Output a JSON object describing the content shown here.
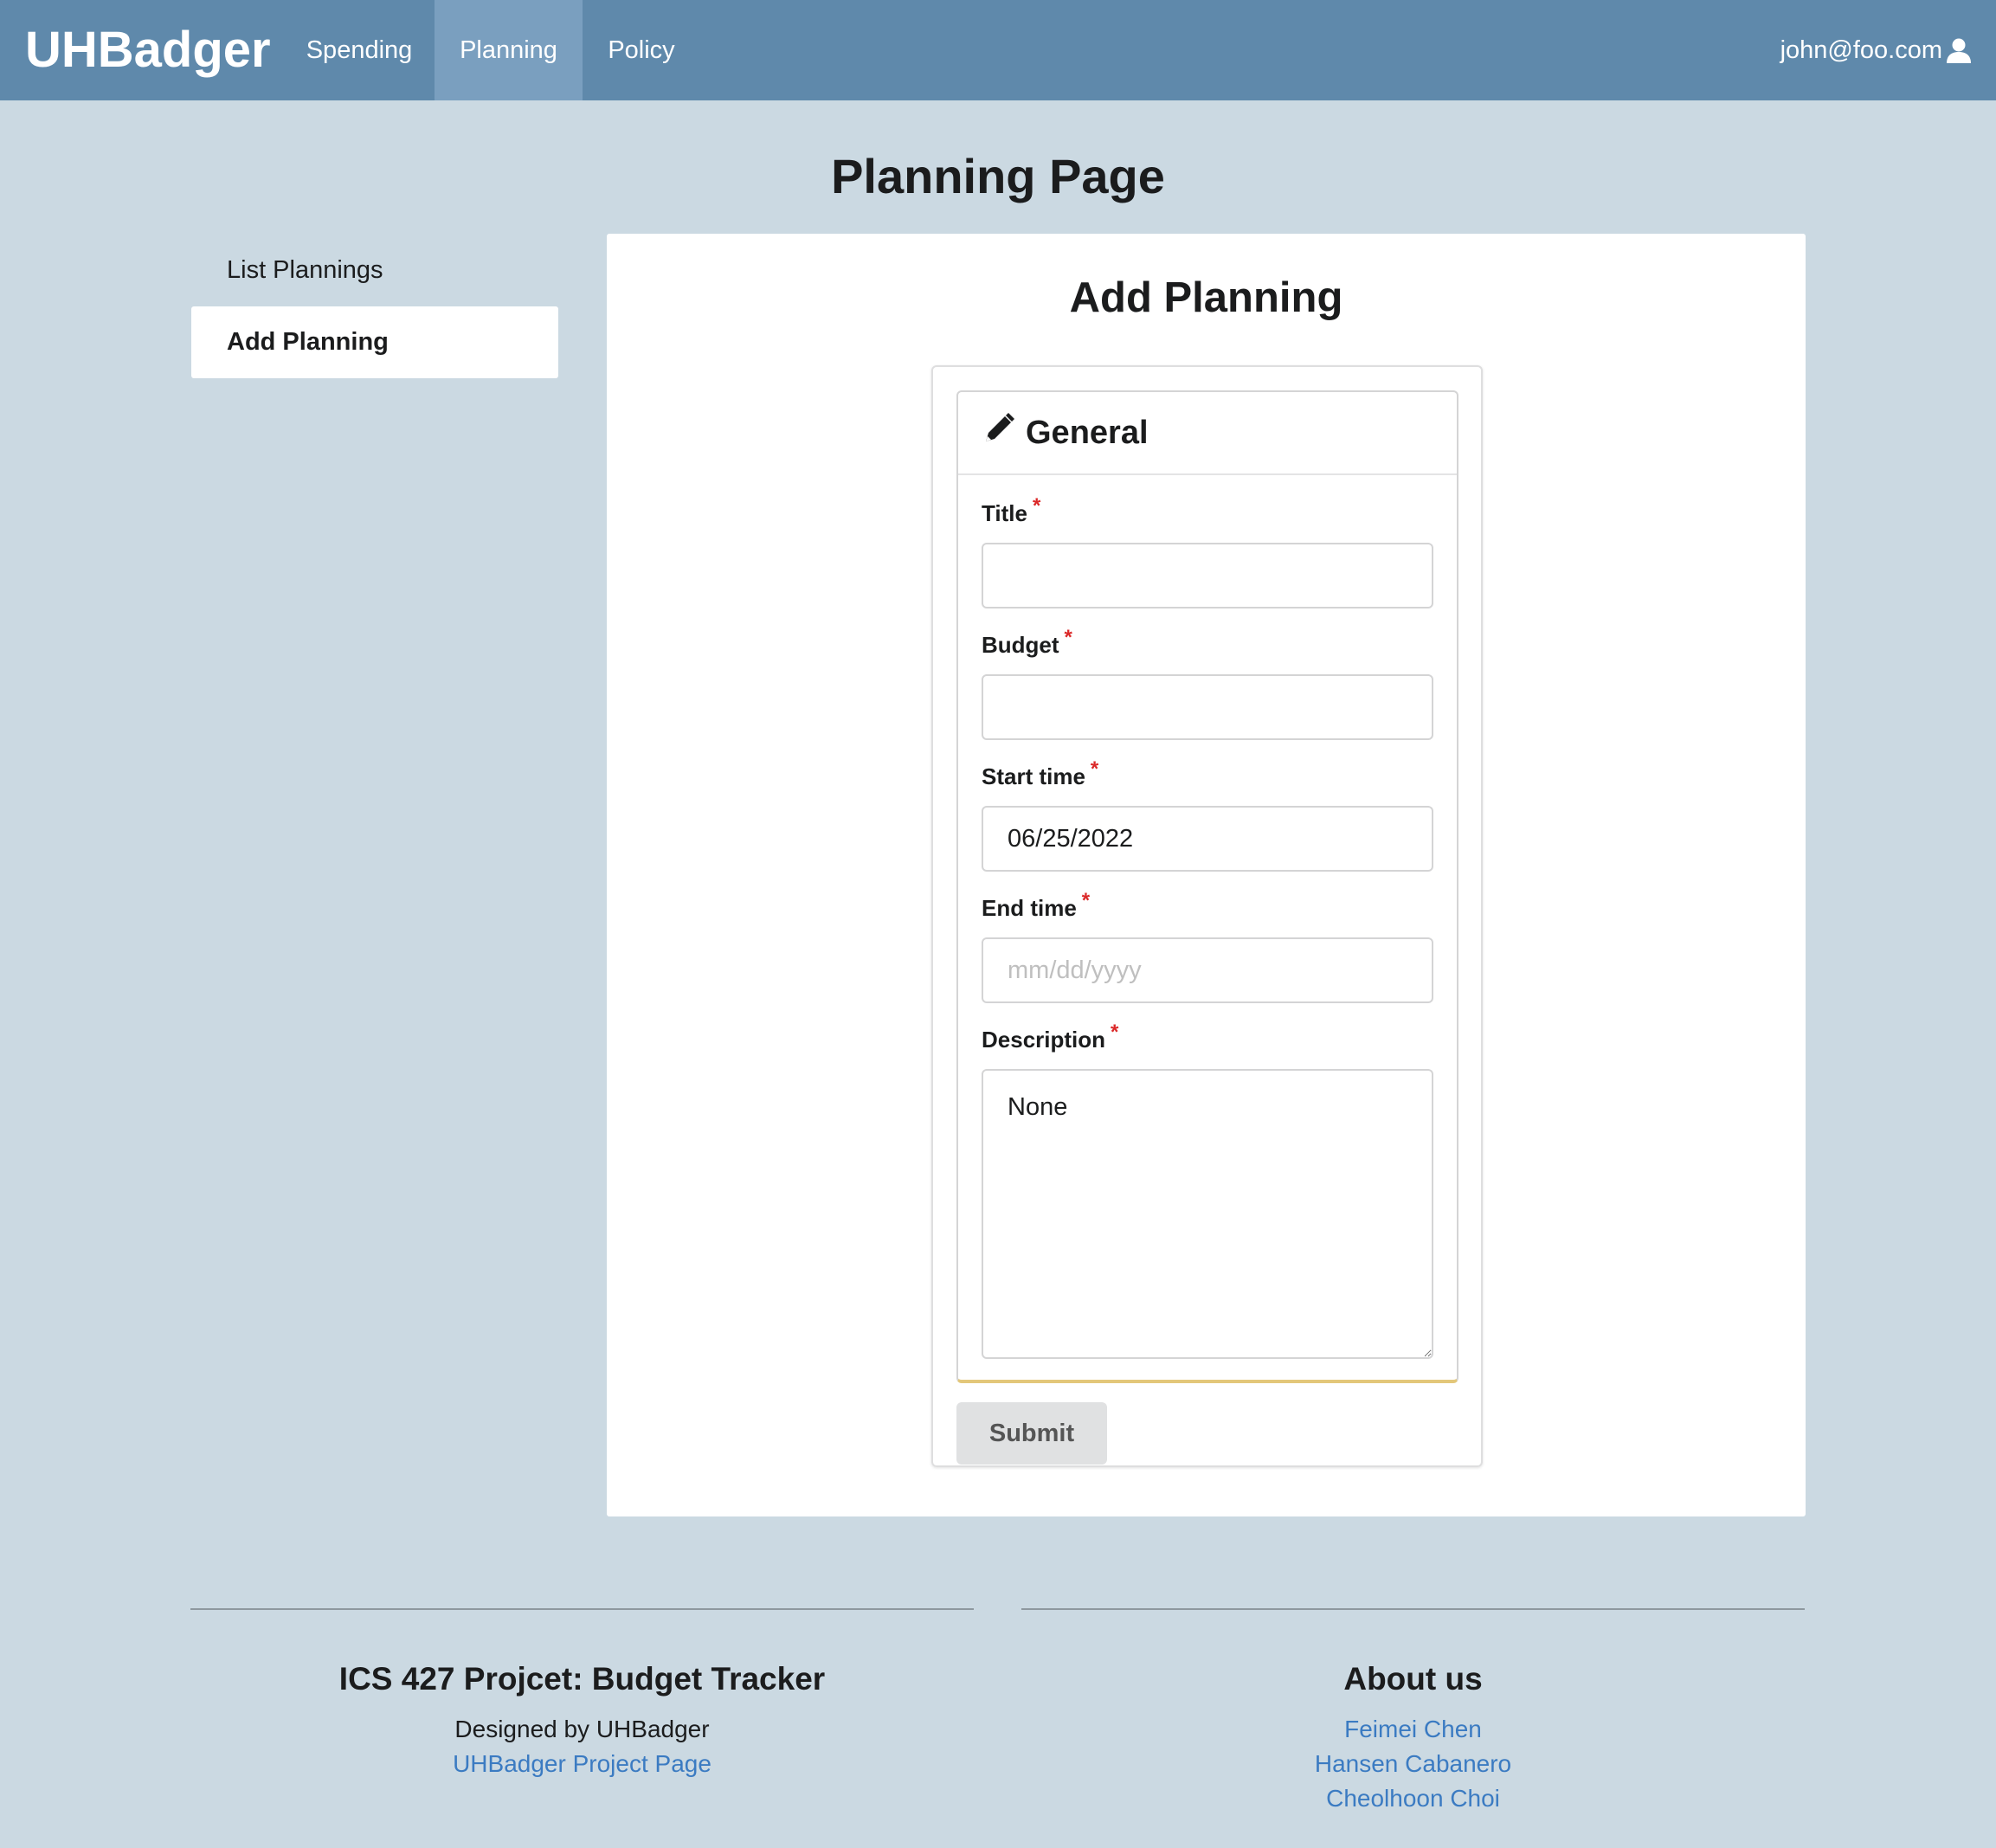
{
  "nav": {
    "brand": "UHBadger",
    "items": [
      {
        "label": "Spending",
        "active": false
      },
      {
        "label": "Planning",
        "active": true
      },
      {
        "label": "Policy",
        "active": false
      }
    ],
    "user": "john@foo.com",
    "user_icon": "user-icon",
    "bg_color": "#5f89ab"
  },
  "page": {
    "title": "Planning Page"
  },
  "sidemenu": {
    "items": [
      {
        "label": "List Plannings",
        "active": false
      },
      {
        "label": "Add Planning",
        "active": true
      }
    ]
  },
  "form": {
    "heading": "Add Planning",
    "section_title": "General",
    "section_icon": "pencil-icon",
    "required_marker": "*",
    "fields": {
      "title": {
        "label": "Title",
        "value": "",
        "placeholder": ""
      },
      "budget": {
        "label": "Budget",
        "value": "",
        "placeholder": ""
      },
      "start_time": {
        "label": "Start time",
        "value": "06/25/2022",
        "placeholder": ""
      },
      "end_time": {
        "label": "End time",
        "value": "",
        "placeholder": "mm/dd/yyyy"
      },
      "description": {
        "label": "Description",
        "value": "None"
      }
    },
    "submit_label": "Submit"
  },
  "footer": {
    "left": {
      "heading": "ICS 427 Projcet: Budget Tracker",
      "designed_by": "Designed by UHBadger",
      "link": "UHBadger Project Page"
    },
    "right": {
      "heading": "About us",
      "members": [
        "Feimei Chen",
        "Hansen Cabanero",
        "Cheolhoon Choi"
      ]
    },
    "link_color": "#3b7bc2"
  }
}
